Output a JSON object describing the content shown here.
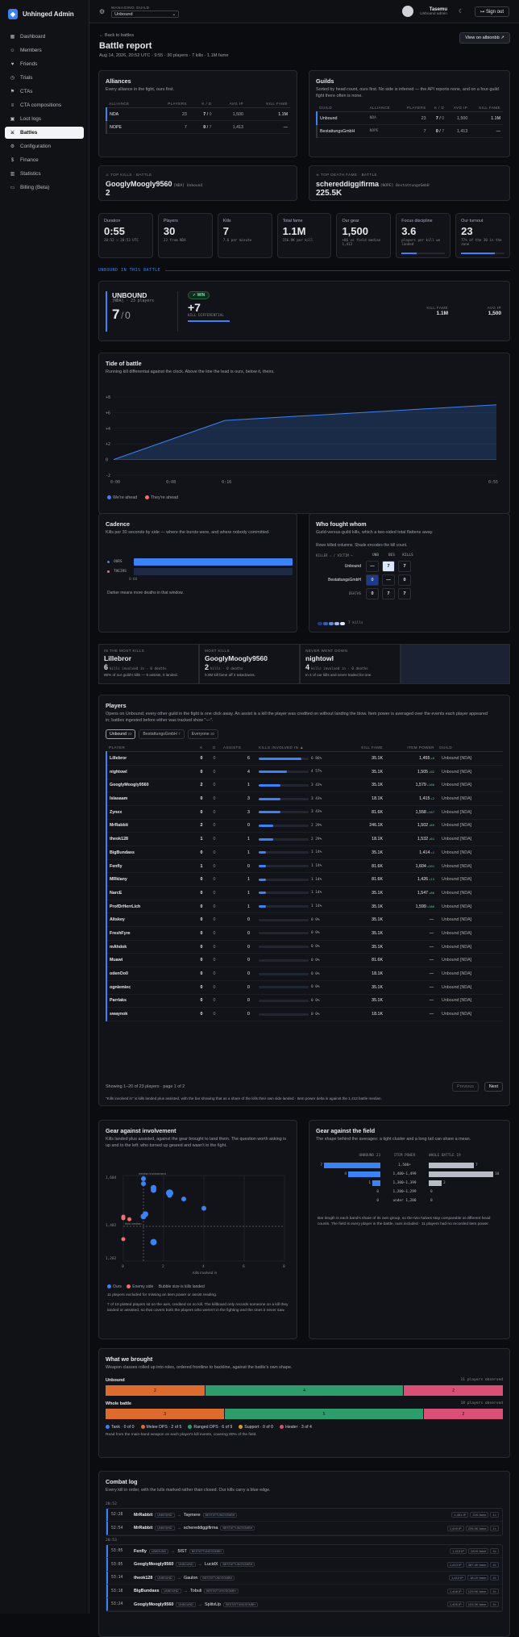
{
  "app": {
    "title": "Unhinged Admin"
  },
  "nav": [
    {
      "label": "Dashboard",
      "icon": "dashboard-icon",
      "glyph": "▦"
    },
    {
      "label": "Members",
      "icon": "members-icon",
      "glyph": "☺"
    },
    {
      "label": "Friends",
      "icon": "friends-icon",
      "glyph": "♥"
    },
    {
      "label": "Trials",
      "icon": "trials-icon",
      "glyph": "◷"
    },
    {
      "label": "CTAs",
      "icon": "ctas-icon",
      "glyph": "⚑"
    },
    {
      "label": "CTA compositions",
      "icon": "compositions-icon",
      "glyph": "≡"
    },
    {
      "label": "Loot logs",
      "icon": "loot-icon",
      "glyph": "▣"
    },
    {
      "label": "Battles",
      "icon": "battles-icon",
      "glyph": "⚔",
      "active": true
    },
    {
      "label": "Configuration",
      "icon": "gear-icon",
      "glyph": "⚙"
    },
    {
      "label": "Finance",
      "icon": "finance-icon",
      "glyph": "$"
    },
    {
      "label": "Statistics",
      "icon": "statistics-icon",
      "glyph": "▥"
    },
    {
      "label": "Billing (Beta)",
      "icon": "billing-icon",
      "glyph": "▭"
    }
  ],
  "topbar": {
    "guild_label": "MANAGING GUILD",
    "guild_value": "Unbound",
    "user": "Tasemu",
    "role": "Unbound admin",
    "signout": "Sign out"
  },
  "header": {
    "back": "← Back to battles",
    "title": "Battle report",
    "meta": "Aug 14, 2026, 20:52 UTC · 9:55 · 30 players · 7 kills · 1.1M fame",
    "albion": "View on albionbb ↗"
  },
  "alliances": {
    "title": "Alliances",
    "sub": "Every alliance in the fight, ours first.",
    "cols": [
      "ALLIANCE",
      "PLAYERS",
      "K / D",
      "AVG IP",
      "KILL FAME"
    ],
    "rows": [
      [
        "NDA",
        "23",
        "7",
        "0",
        "1,500",
        "1.1M"
      ],
      [
        "NOPE",
        "7",
        "0",
        "7",
        "1,413",
        "—"
      ]
    ]
  },
  "guilds": {
    "title": "Guilds",
    "sub": "Sorted by head count, ours first. No side is inferred — the API reports none, and on a four-guild fight there often is none.",
    "cols": [
      "GUILD",
      "ALLIANCE",
      "PLAYERS",
      "K / D",
      "AVG IP",
      "KILL FAME"
    ],
    "rows": [
      [
        "Unbound",
        "NDA",
        "23",
        "7",
        "0",
        "1,500",
        "1.1M"
      ],
      [
        "BestattungsGmbH",
        "NOPE",
        "7",
        "0",
        "7",
        "1,413",
        "—"
      ]
    ]
  },
  "top_killer": {
    "label": "TOP KILLS · BATTLE",
    "name": "GooglyMoogly9560",
    "meta": "[NDA] Unbound",
    "value": "2"
  },
  "top_fame": {
    "label": "TOP DEATH FAME · BATTLE",
    "name": "schereddiggifirma",
    "meta": "[NOPE] BestattungsGmbH",
    "value": "225.5K"
  },
  "stats": [
    {
      "label": "Duration",
      "value": "0:55",
      "sub": "20:52 → 20:53 UTC"
    },
    {
      "label": "Players",
      "value": "30",
      "sub": "23 from NDA"
    },
    {
      "label": "Kills",
      "value": "7",
      "sub": "7.6 per minute"
    },
    {
      "label": "Total fame",
      "value": "1.1M",
      "sub": "156.9K per kill"
    },
    {
      "label": "Our gear",
      "value": "1,500",
      "sub": "+86 vs field median 1,413"
    },
    {
      "label": "Focus discipline",
      "value": "3.6",
      "sub": "players per kill we landed"
    },
    {
      "label": "Our turnout",
      "value": "23",
      "sub": "77% of the 30 in the zone"
    }
  ],
  "section_label": "UNBOUND IN THIS BATTLE",
  "ours": {
    "name": "UNBOUND",
    "meta": "[NDA] · 23 players",
    "kills": "7",
    "slash": "/",
    "deaths": "0",
    "win": "✓ WIN",
    "diff": "+7",
    "diff_label": "KILL DIFFERENTIAL",
    "fame_label": "KILL FAME",
    "fame": "1.1M",
    "ip_label": "AVG IP",
    "ip": "1,500"
  },
  "tide": {
    "title": "Tide of battle",
    "sub": "Running kill differential against the clock. Above the line the lead is ours, below it, theirs.",
    "legend_ours": "We're ahead",
    "legend_theirs": "They're ahead"
  },
  "chart_data": {
    "type": "area",
    "x": [
      "0:00",
      "0:08",
      "0:16",
      "0:55"
    ],
    "series": [
      {
        "name": "We're ahead",
        "values": [
          0,
          2.5,
          5,
          7
        ]
      }
    ],
    "yticks": [
      "+8",
      "+6",
      "+4",
      "+2",
      "0",
      "-2"
    ],
    "ylim": [
      -2,
      8
    ]
  },
  "cadence": {
    "title": "Cadence",
    "sub": "Kills per 30 seconds by side — where the bursts were, and where nobody committed.",
    "ours": "OURS",
    "theirs": "THEIRS",
    "start": "0:00",
    "note": "Darker means more deaths in that window."
  },
  "who": {
    "title": "Who fought whom",
    "sub": "Guild-versus-guild kills, which a two-sided total flattens away.",
    "note": "Rows killed columns. Shade encodes the kill count.",
    "corner": "KILLER ↓ / VICTIM →",
    "cols": [
      "UNB",
      "BES",
      "KILLS"
    ],
    "rows": [
      [
        "Unbound",
        "—",
        "7",
        "7"
      ],
      [
        "BestattungsGmbH",
        "0",
        "—",
        "0"
      ],
      [
        "DEATHS",
        "0",
        "7",
        "7"
      ]
    ],
    "scale_label": "7 kills"
  },
  "highlights": [
    {
      "label": "IN THE MOST KILLS",
      "name": "Lillebror",
      "value": "6",
      "vlabel": "kills involved in · 0 deaths",
      "sub": "86% of our guild's kills — 6 assists, 0 landed."
    },
    {
      "label": "MOST KILLS",
      "name": "GooglyMoogly9560",
      "value": "2",
      "vlabel": "kills · 0 deaths",
      "sub": "0.0M kill fame off 2 takedowns."
    },
    {
      "label": "NEVER WENT DOWN",
      "name": "nightowl",
      "value": "4",
      "vlabel": "kills involved in · 0 deaths",
      "sub": "In 4 of our kills and never traded for one."
    }
  ],
  "players": {
    "title": "Players",
    "sub": "Opens on Unbound; every other guild in the fight is one click away. An assist is a kill the player was credited on without landing the blow. Item power is averaged over the events each player appeared in; battles ingested before either was tracked show \"—\".",
    "tabs": [
      {
        "label": "Unbound",
        "count": "23"
      },
      {
        "label": "BestattungsGmbH",
        "count": "7"
      },
      {
        "label": "Everyone",
        "count": "30"
      }
    ],
    "cols": [
      "PLAYER",
      "K",
      "D",
      "ASSISTS",
      "KILLS INVOLVED IN ▲",
      "KILL FAME",
      "ITEM POWER",
      "GUILD"
    ],
    "rows": [
      {
        "name": "Lillebror",
        "k": "0",
        "d": "0",
        "a": "6",
        "inv": 0.86,
        "pct": "6 86%",
        "fame": "35.1K",
        "ip": "1,455",
        "delta": "+6",
        "guild": "Unbound [NDA]"
      },
      {
        "name": "nightowl",
        "k": "0",
        "d": "0",
        "a": "4",
        "inv": 0.57,
        "pct": "4 57%",
        "fame": "35.1K",
        "ip": "1,505",
        "delta": "+92",
        "guild": "Unbound [NDA]"
      },
      {
        "name": "GooglyMoogly9560",
        "k": "2",
        "d": "0",
        "a": "1",
        "inv": 0.43,
        "pct": "3 43%",
        "fame": "35.1K",
        "ip": "1,579",
        "delta": "+166",
        "guild": "Unbound [NDA]"
      },
      {
        "name": "Islasaam",
        "k": "0",
        "d": "0",
        "a": "3",
        "inv": 0.43,
        "pct": "3 43%",
        "fame": "18.1K",
        "ip": "1,415",
        "delta": "+2",
        "guild": "Unbound [NDA]"
      },
      {
        "name": "Zynex",
        "k": "0",
        "d": "0",
        "a": "3",
        "inv": 0.43,
        "pct": "3 43%",
        "fame": "81.6K",
        "ip": "1,558",
        "delta": "+167",
        "guild": "Unbound [NDA]"
      },
      {
        "name": "MrRabbit",
        "k": "2",
        "d": "0",
        "a": "0",
        "inv": 0.29,
        "pct": "2 29%",
        "fame": "246.1K",
        "ip": "1,502",
        "delta": "+89",
        "guild": "Unbound [NDA]"
      },
      {
        "name": "theok128",
        "k": "1",
        "d": "0",
        "a": "1",
        "inv": 0.29,
        "pct": "2 29%",
        "fame": "18.1K",
        "ip": "1,532",
        "delta": "+61",
        "guild": "Unbound [NDA]"
      },
      {
        "name": "BigBundass",
        "k": "0",
        "d": "0",
        "a": "1",
        "inv": 0.14,
        "pct": "1 14%",
        "fame": "35.1K",
        "ip": "1,414",
        "delta": "+1",
        "guild": "Unbound [NDA]"
      },
      {
        "name": "Fenfly",
        "k": "1",
        "d": "0",
        "a": "0",
        "inv": 0.14,
        "pct": "1 14%",
        "fame": "81.6K",
        "ip": "1,604",
        "delta": "+191",
        "guild": "Unbound [NDA]"
      },
      {
        "name": "MRklany",
        "k": "0",
        "d": "0",
        "a": "1",
        "inv": 0.14,
        "pct": "1 14%",
        "fame": "81.6K",
        "ip": "1,426",
        "delta": "+13",
        "guild": "Unbound [NDA]"
      },
      {
        "name": "NarcE",
        "k": "0",
        "d": "0",
        "a": "1",
        "inv": 0.14,
        "pct": "1 14%",
        "fame": "35.1K",
        "ip": "1,547",
        "delta": "+86",
        "guild": "Unbound [NDA]"
      },
      {
        "name": "ProfDrHerrLich",
        "k": "0",
        "d": "0",
        "a": "1",
        "inv": 0.14,
        "pct": "1 14%",
        "fame": "35.1K",
        "ip": "1,599",
        "delta": "+186",
        "guild": "Unbound [NDA]"
      },
      {
        "name": "Altskey",
        "k": "0",
        "d": "0",
        "a": "0",
        "inv": 0,
        "pct": "0 0%",
        "fame": "35.1K",
        "ip": "—",
        "delta": "",
        "guild": "Unbound [NDA]"
      },
      {
        "name": "FreshFyre",
        "k": "0",
        "d": "0",
        "a": "0",
        "inv": 0,
        "pct": "0 0%",
        "fame": "35.1K",
        "ip": "—",
        "delta": "",
        "guild": "Unbound [NDA]"
      },
      {
        "name": "mAhdok",
        "k": "0",
        "d": "0",
        "a": "0",
        "inv": 0,
        "pct": "0 0%",
        "fame": "35.1K",
        "ip": "—",
        "delta": "",
        "guild": "Unbound [NDA]"
      },
      {
        "name": "Muawi",
        "k": "0",
        "d": "0",
        "a": "0",
        "inv": 0,
        "pct": "0 0%",
        "fame": "81.6K",
        "ip": "—",
        "delta": "",
        "guild": "Unbound [NDA]"
      },
      {
        "name": "odenOo0",
        "k": "0",
        "d": "0",
        "a": "0",
        "inv": 0,
        "pct": "0 0%",
        "fame": "18.1K",
        "ip": "—",
        "delta": "",
        "guild": "Unbound [NDA]"
      },
      {
        "name": "ogniemiec",
        "k": "0",
        "d": "0",
        "a": "0",
        "inv": 0,
        "pct": "0 0%",
        "fame": "35.1K",
        "ip": "—",
        "delta": "",
        "guild": "Unbound [NDA]"
      },
      {
        "name": "Parrlaks",
        "k": "0",
        "d": "0",
        "a": "0",
        "inv": 0,
        "pct": "0 0%",
        "fame": "35.1K",
        "ip": "—",
        "delta": "",
        "guild": "Unbound [NDA]"
      },
      {
        "name": "swaynok",
        "k": "0",
        "d": "0",
        "a": "0",
        "inv": 0,
        "pct": "0 0%",
        "fame": "18.1K",
        "ip": "—",
        "delta": "",
        "guild": "Unbound [NDA]"
      }
    ],
    "footer": "Showing 1–20 of 23 players · page 1 of 2",
    "prev": "Previous",
    "next": "Next",
    "note": "\"Kills involved in\" is kills landed plus assisted, with the bar showing that as a share of the kills their own side landed · Item power delta is against the 1,413 battle median."
  },
  "gear": {
    "title": "Gear against involvement",
    "sub": "Kills landed plus assisted, against the gear brought to land them. The question worth asking is up and to the left: who turned up geared and wasn't in the fight.",
    "median": "median involvement",
    "field": "field median",
    "xlabel": "Kills involved in",
    "yticks": [
      "1,604",
      "1,402",
      "1,202"
    ],
    "xticks": [
      "0",
      "2",
      "4",
      "6",
      "8"
    ],
    "legend": [
      "Ours",
      "Enemy side",
      "Bubble size is kills landed"
    ],
    "note1": "11 players excluded for missing an item power or assist reading.",
    "note2": "7 of 19 plotted players sit on the axis, credited on no kill. The killboard only records someone on a kill they landed or assisted, so that covers both the players who weren't in the fighting and the ones it never saw."
  },
  "field": {
    "title": "Gear against the field",
    "sub": "The shape behind the averages: a tight cluster and a long tail can share a mean.",
    "h1": "UNBOUND",
    "h1c": "23",
    "h2": "ITEM POWER",
    "h3": "WHOLE BATTLE",
    "h3c": "19",
    "rows": [
      {
        "band": "1,500+",
        "a": 7,
        "b": 7
      },
      {
        "band": "1,400–1,499",
        "a": 4,
        "b": 10
      },
      {
        "band": "1,300–1,399",
        "a": 1,
        "b": 2
      },
      {
        "band": "1,200–1,299",
        "a": 0,
        "b": 0
      },
      {
        "band": "under 1,200",
        "a": 0,
        "b": 0
      }
    ],
    "note": "Bar length is each band's share of its own group, so the two halves stay comparable at different head counts. The field is every player in the battle, ours included · 11 players had no recorded item power."
  },
  "weapons": {
    "title": "What we brought",
    "sub": "Weapon classes rolled up into roles, ordered frontline to backline, against the battle's own shape.",
    "ours": "Unbound",
    "ours_n": "11 players observed",
    "all": "Whole battle",
    "all_n": "18 players observed",
    "ours_bars": [
      {
        "v": 2,
        "c": "#dd6b2e"
      },
      {
        "v": 4,
        "c": "#2d9e6b"
      },
      {
        "v": 2,
        "c": "#d94f76"
      }
    ],
    "all_bars": [
      {
        "v": 3,
        "c": "#dd6b2e"
      },
      {
        "v": 5,
        "c": "#2d9e6b"
      },
      {
        "v": 2,
        "c": "#d94f76"
      }
    ],
    "legend": [
      {
        "t": "Tank · 0 of 0",
        "c": "#3b82f6"
      },
      {
        "t": "Melee DPS · 2 of 5",
        "c": "#dd6b2e"
      },
      {
        "t": "Ranged DPS · 6 of 9",
        "c": "#2d9e6b"
      },
      {
        "t": "Support · 0 of 0",
        "c": "#c9a227"
      },
      {
        "t": "Healer · 3 of 4",
        "c": "#d94f76"
      }
    ],
    "note": "Read from the main-hand weapon on each player's kill events, covering 80% of the field."
  },
  "log": {
    "title": "Combat log",
    "sub": "Every kill in order, with the lulls marked rather than closed. Our kills carry a blue edge.",
    "groups": [
      {
        "time": "20:52",
        "rows": [
          {
            "t": "52:28",
            "k": "MrRabbit",
            "kt": "UNBOUND",
            "v": "Taymere",
            "vt": "BESTATTUNGSGMBH",
            "ip": "1,451 IP",
            "fame": "21K fame",
            "n": "1×"
          },
          {
            "t": "52:54",
            "k": "MrRabbit",
            "kt": "UNBOUND",
            "v": "schereddiggifirma",
            "vt": "BESTATTUNGSGMBH",
            "ip": "1,409 IP",
            "fame": "225.5K fame",
            "n": "1×"
          }
        ]
      },
      {
        "time": "20:53",
        "rows": [
          {
            "t": "53:05",
            "k": "Fenfly",
            "kt": "UNBOUND",
            "v": "5IST",
            "vt": "BESTATTUNGSGMBH",
            "ip": "1,413 IP",
            "fame": "241K fame",
            "n": "4×"
          },
          {
            "t": "53:05",
            "k": "GooglyMoogly9560",
            "kt": "UNBOUND",
            "v": "LucidX",
            "vt": "BESTATTUNGSGMBH",
            "ip": "1,413 IP",
            "fame": "387.4K fame",
            "n": "4×"
          },
          {
            "t": "53:14",
            "k": "theok128",
            "kt": "UNBOUND",
            "v": "Gaulon",
            "vt": "BESTATTUNGSGMBH",
            "ip": "1,413 IP",
            "fame": "18.1K fame",
            "n": "4×"
          },
          {
            "t": "53:18",
            "k": "BigBundass",
            "kt": "UNBOUND",
            "v": "Tobuli",
            "vt": "BESTATTUNGSGMBH",
            "ip": "1,408 IP",
            "fame": "129.5K fame",
            "n": "4×"
          },
          {
            "t": "53:24",
            "k": "GooglyMoogly9560",
            "kt": "UNBOUND",
            "v": "SplitxUp",
            "vt": "BESTATTUNGSGMBH",
            "ip": "1,405 IP",
            "fame": "103.3K fame",
            "n": "4×"
          }
        ]
      }
    ]
  }
}
